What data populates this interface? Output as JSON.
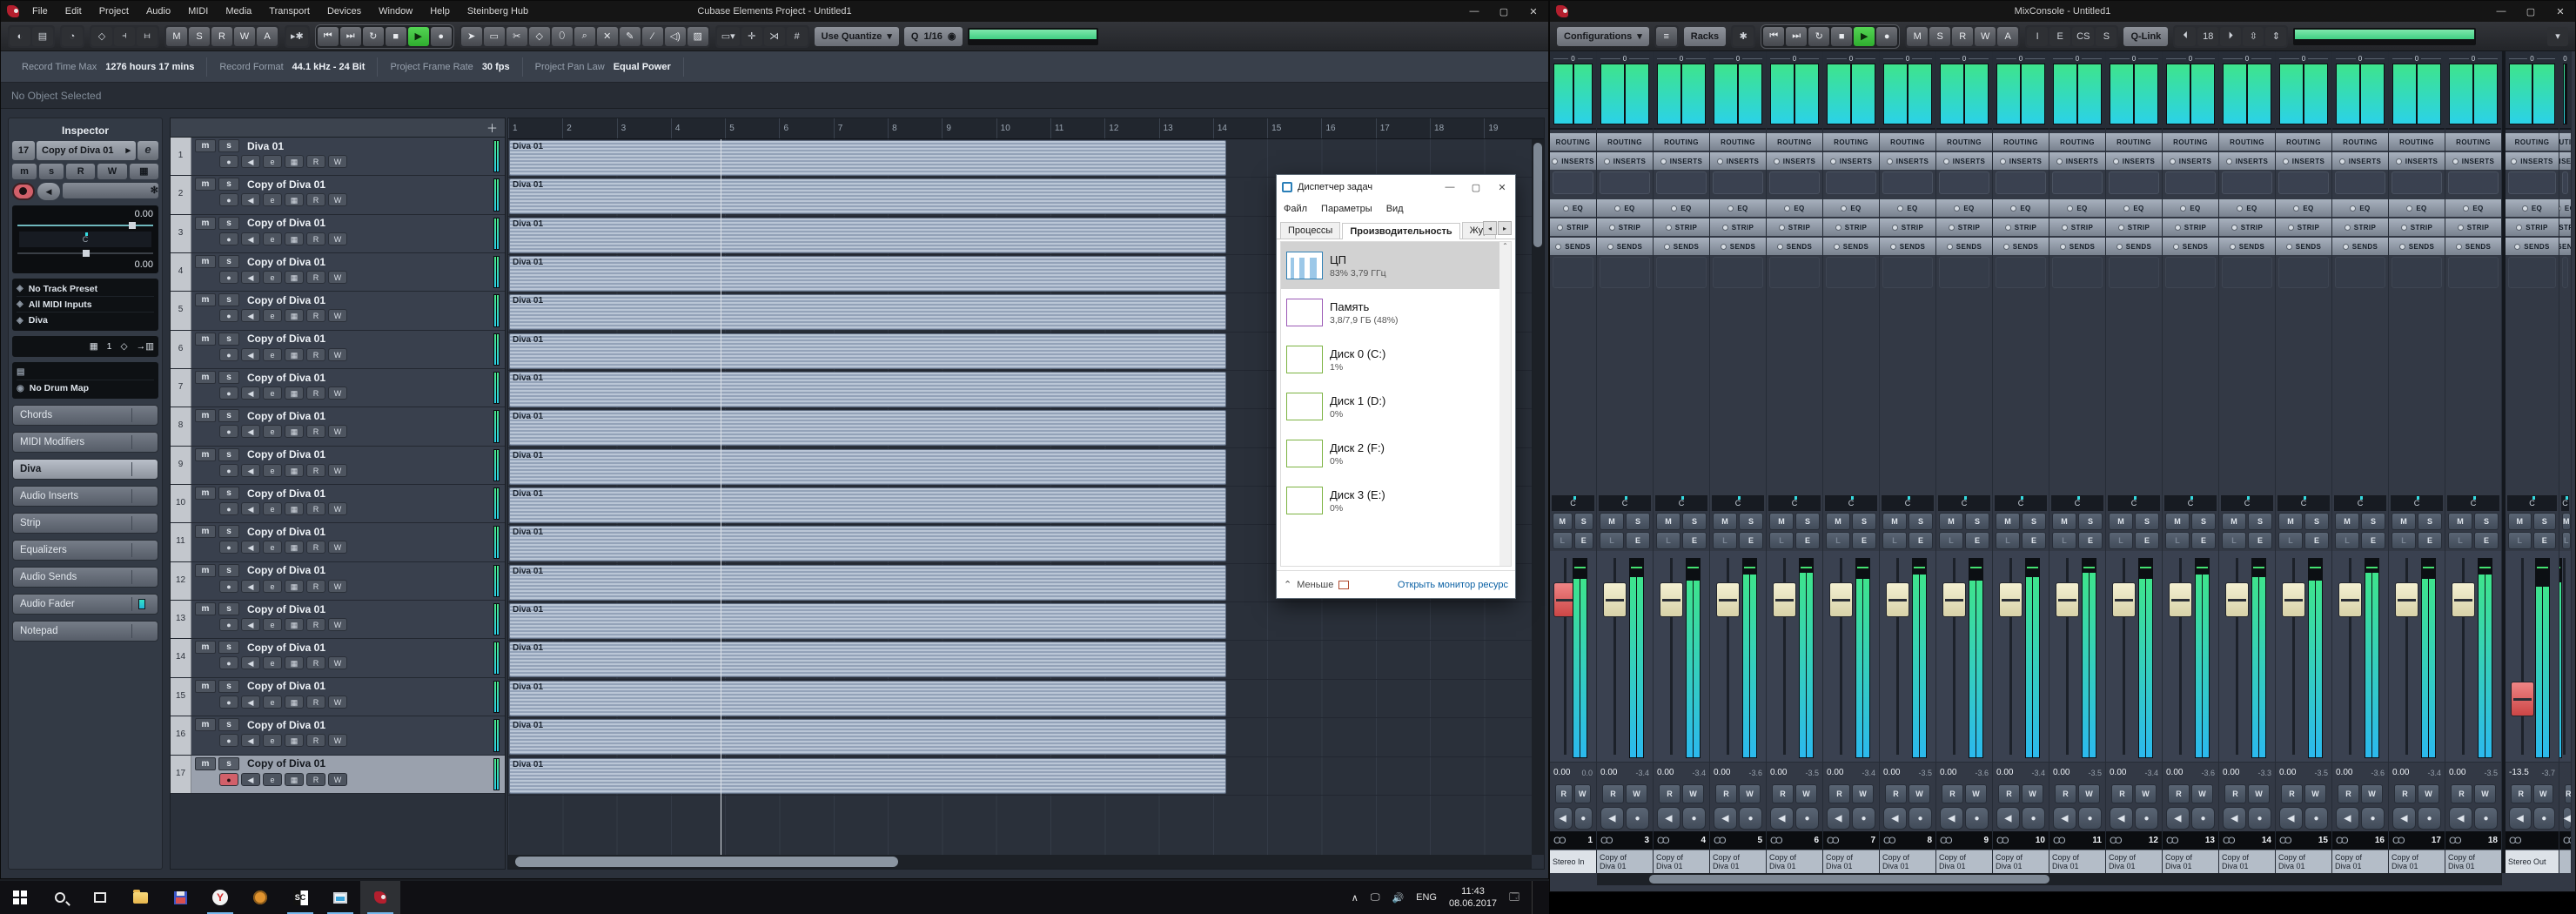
{
  "cubase": {
    "title": "Cubase Elements Project - Untitled1",
    "menu": [
      "File",
      "Edit",
      "Project",
      "Audio",
      "MIDI",
      "Media",
      "Transport",
      "Devices",
      "Window",
      "Help",
      "Steinberg Hub"
    ],
    "toolbar": {
      "automation": [
        "M",
        "S",
        "R",
        "W",
        "A"
      ],
      "quantize_label": "Use Quantize",
      "quantize_q": "Q",
      "quantize_value": "1/16"
    },
    "info_line": [
      {
        "label": "Record Time Max",
        "value": "1276 hours 17 mins"
      },
      {
        "label": "Record Format",
        "value": "44.1 kHz - 24 Bit"
      },
      {
        "label": "Project Frame Rate",
        "value": "30 fps"
      },
      {
        "label": "Project Pan Law",
        "value": "Equal Power"
      }
    ],
    "status_line": "No Object Selected",
    "inspector": {
      "title": "Inspector",
      "track_number": "17",
      "track_name": "Copy of Diva 01",
      "edit_label": "e",
      "btns": {
        "m": "m",
        "s": "s",
        "r": "R",
        "w": "W"
      },
      "volume": "0.00",
      "pan": "C",
      "delay": "0.00",
      "routing": [
        {
          "icon": "preset-diamond-icon",
          "text": "No Track Preset"
        },
        {
          "icon": "midi-input-icon",
          "text": "All MIDI Inputs"
        },
        {
          "icon": "midi-output-icon",
          "text": "Diva"
        }
      ],
      "channel": "1",
      "drum_map": "No Drum Map",
      "sections": [
        {
          "label": "Chords",
          "cls": "",
          "icls": ""
        },
        {
          "label": "MIDI Modifiers",
          "cls": "",
          "icls": ""
        },
        {
          "label": "Diva",
          "cls": "inst",
          "icls": ""
        },
        {
          "label": "Audio Inserts",
          "cls": "",
          "icls": ""
        },
        {
          "label": "Strip",
          "cls": "",
          "icls": ""
        },
        {
          "label": "Equalizers",
          "cls": "",
          "icls": ""
        },
        {
          "label": "Audio Sends",
          "cls": "",
          "icls": ""
        },
        {
          "label": "Audio Fader",
          "cls": "",
          "icls": "teal"
        },
        {
          "label": "Notepad",
          "cls": "",
          "icls": ""
        }
      ]
    },
    "track_btns": {
      "m": "m",
      "s": "s",
      "e": "e",
      "inst": "▦",
      "r": "R",
      "w": "W"
    },
    "tracks": [
      {
        "num": "1",
        "name": "Diva 01",
        "sel": ""
      },
      {
        "num": "2",
        "name": "Copy of Diva 01",
        "sel": ""
      },
      {
        "num": "3",
        "name": "Copy of Diva 01",
        "sel": ""
      },
      {
        "num": "4",
        "name": "Copy of Diva 01",
        "sel": ""
      },
      {
        "num": "5",
        "name": "Copy of Diva 01",
        "sel": ""
      },
      {
        "num": "6",
        "name": "Copy of Diva 01",
        "sel": ""
      },
      {
        "num": "7",
        "name": "Copy of Diva 01",
        "sel": ""
      },
      {
        "num": "8",
        "name": "Copy of Diva 01",
        "sel": ""
      },
      {
        "num": "9",
        "name": "Copy of Diva 01",
        "sel": ""
      },
      {
        "num": "10",
        "name": "Copy of Diva 01",
        "sel": ""
      },
      {
        "num": "11",
        "name": "Copy of Diva 01",
        "sel": ""
      },
      {
        "num": "12",
        "name": "Copy of Diva 01",
        "sel": ""
      },
      {
        "num": "13",
        "name": "Copy of Diva 01",
        "sel": ""
      },
      {
        "num": "14",
        "name": "Copy of Diva 01",
        "sel": ""
      },
      {
        "num": "15",
        "name": "Copy of Diva 01",
        "sel": ""
      },
      {
        "num": "16",
        "name": "Copy of Diva 01",
        "sel": ""
      },
      {
        "num": "17",
        "name": "Copy of Diva 01",
        "sel": "sel",
        "rec": "rec-on"
      }
    ],
    "ruler_bars": [
      "1",
      "2",
      "3",
      "4",
      "5",
      "6",
      "7",
      "8",
      "9",
      "10",
      "11",
      "12",
      "13",
      "14",
      "15",
      "16",
      "17",
      "18",
      "19"
    ],
    "part_label": "Diva 01"
  },
  "taskmanager": {
    "title": "Диспетчер задач",
    "menu": [
      "Файл",
      "Параметры",
      "Вид"
    ],
    "tabs": [
      {
        "label": "Процессы",
        "on": ""
      },
      {
        "label": "Производительность",
        "on": "on"
      },
      {
        "label": "Жур",
        "on": ""
      }
    ],
    "items": [
      {
        "name": "ЦП",
        "value": "83% 3,79 ГГц",
        "gcls": "cpu",
        "c": "#2f7fb5",
        "sel": "sel"
      },
      {
        "name": "Память",
        "value": "3,8/7,9 ГБ (48%)",
        "gcls": "",
        "c": "#9b59b6",
        "sel": ""
      },
      {
        "name": "Диск 0 (C:)",
        "value": "1%",
        "gcls": "",
        "c": "#7cb342",
        "sel": ""
      },
      {
        "name": "Диск 1 (D:)",
        "value": "0%",
        "gcls": "",
        "c": "#7cb342",
        "sel": ""
      },
      {
        "name": "Диск 2 (F:)",
        "value": "0%",
        "gcls": "",
        "c": "#7cb342",
        "sel": ""
      },
      {
        "name": "Диск 3 (E:)",
        "value": "0%",
        "gcls": "",
        "c": "#7cb342",
        "sel": ""
      }
    ],
    "footer": {
      "less": "Меньше",
      "link": "Открыть монитор ресурс"
    }
  },
  "mixconsole": {
    "title": "MixConsole - Untitled1",
    "toolbar": {
      "configurations": "Configurations",
      "racks": "Racks",
      "automation": [
        "M",
        "S",
        "R",
        "W",
        "A"
      ],
      "listen": [
        "I",
        "E",
        "CS",
        "S"
      ],
      "qlink": "Q-Link",
      "bank": "18"
    },
    "rack_labels": {
      "routing": "ROUTING",
      "inserts": "INSERTS",
      "eq": "EQ",
      "strip": "STRIP",
      "sends": "SENDS"
    },
    "bridge_zero": "0",
    "pan_center": "C",
    "ch_btns": {
      "m": "M",
      "s": "S",
      "l": "L",
      "e": "E",
      "r": "R",
      "w": "W"
    },
    "channels": [
      {
        "num": "1",
        "l1": "Stereo In",
        "l2": "",
        "db": "0.00",
        "peak": "0.0",
        "cap": "cap-red",
        "pos": "36px",
        "mh": "90%",
        "cls": "ch-stereo-in",
        "lab": "lab-hl"
      },
      {
        "num": "3",
        "l1": "Copy of",
        "l2": "Diva 01",
        "db": "0.00",
        "peak": "-3.4",
        "cap": "cap-cream",
        "pos": "36px",
        "mh": "91%",
        "cls": "",
        "lab": ""
      },
      {
        "num": "4",
        "l1": "Copy of",
        "l2": "Diva 01",
        "db": "0.00",
        "peak": "-3.4",
        "cap": "cap-cream",
        "pos": "36px",
        "mh": "89%",
        "cls": "",
        "lab": ""
      },
      {
        "num": "5",
        "l1": "Copy of",
        "l2": "Diva 01",
        "db": "0.00",
        "peak": "-3.6",
        "cap": "cap-cream",
        "pos": "36px",
        "mh": "92%",
        "cls": "",
        "lab": ""
      },
      {
        "num": "6",
        "l1": "Copy of",
        "l2": "Diva 01",
        "db": "0.00",
        "peak": "-3.5",
        "cap": "cap-cream",
        "pos": "36px",
        "mh": "93%",
        "cls": "",
        "lab": ""
      },
      {
        "num": "7",
        "l1": "Copy of",
        "l2": "Diva 01",
        "db": "0.00",
        "peak": "-3.4",
        "cap": "cap-cream",
        "pos": "36px",
        "mh": "90%",
        "cls": "",
        "lab": ""
      },
      {
        "num": "8",
        "l1": "Copy of",
        "l2": "Diva 01",
        "db": "0.00",
        "peak": "-3.5",
        "cap": "cap-cream",
        "pos": "36px",
        "mh": "92%",
        "cls": "",
        "lab": ""
      },
      {
        "num": "9",
        "l1": "Copy of",
        "l2": "Diva 01",
        "db": "0.00",
        "peak": "-3.6",
        "cap": "cap-cream",
        "pos": "36px",
        "mh": "89%",
        "cls": "",
        "lab": ""
      },
      {
        "num": "10",
        "l1": "Copy of",
        "l2": "Diva 01",
        "db": "0.00",
        "peak": "-3.4",
        "cap": "cap-cream",
        "pos": "36px",
        "mh": "91%",
        "cls": "",
        "lab": ""
      },
      {
        "num": "11",
        "l1": "Copy of",
        "l2": "Diva 01",
        "db": "0.00",
        "peak": "-3.5",
        "cap": "cap-cream",
        "pos": "36px",
        "mh": "93%",
        "cls": "",
        "lab": ""
      },
      {
        "num": "12",
        "l1": "Copy of",
        "l2": "Diva 01",
        "db": "0.00",
        "peak": "-3.4",
        "cap": "cap-cream",
        "pos": "36px",
        "mh": "90%",
        "cls": "",
        "lab": ""
      },
      {
        "num": "13",
        "l1": "Copy of",
        "l2": "Diva 01",
        "db": "0.00",
        "peak": "-3.6",
        "cap": "cap-cream",
        "pos": "36px",
        "mh": "92%",
        "cls": "",
        "lab": ""
      },
      {
        "num": "14",
        "l1": "Copy of",
        "l2": "Diva 01",
        "db": "0.00",
        "peak": "-3.3",
        "cap": "cap-cream",
        "pos": "36px",
        "mh": "91%",
        "cls": "",
        "lab": ""
      },
      {
        "num": "15",
        "l1": "Copy of",
        "l2": "Diva 01",
        "db": "0.00",
        "peak": "-3.5",
        "cap": "cap-cream",
        "pos": "36px",
        "mh": "89%",
        "cls": "",
        "lab": ""
      },
      {
        "num": "16",
        "l1": "Copy of",
        "l2": "Diva 01",
        "db": "0.00",
        "peak": "-3.6",
        "cap": "cap-cream",
        "pos": "36px",
        "mh": "93%",
        "cls": "",
        "lab": ""
      },
      {
        "num": "17",
        "l1": "Copy of",
        "l2": "Diva 01",
        "db": "0.00",
        "peak": "-3.4",
        "cap": "cap-cream",
        "pos": "36px",
        "mh": "90%",
        "cls": "",
        "lab": ""
      },
      {
        "num": "18",
        "l1": "Copy of",
        "l2": "Diva 01",
        "db": "0.00",
        "peak": "-3.5",
        "cap": "cap-cream",
        "pos": "36px",
        "mh": "92%",
        "cls": "",
        "lab": ""
      },
      {
        "num": "",
        "l1": "Stereo Out",
        "l2": "",
        "db": "-13.5",
        "peak": "-3.7",
        "cap": "cap-red",
        "pos": "150px",
        "mh": "86%",
        "cls": "ch-out",
        "lab": "lab-hl"
      },
      {
        "num": "",
        "l1": "",
        "l2": "",
        "db": "",
        "peak": "",
        "cap": "cap-none",
        "pos": "36px",
        "mh": "88%",
        "cls": "ch-partial",
        "lab": ""
      }
    ]
  },
  "taskbar": {
    "yandex_letter": "Y",
    "sc_label_left": "S",
    "sc_label_right": "C",
    "tray": {
      "lang": "ENG",
      "time": "11:43",
      "date": "08.06.2017"
    }
  }
}
